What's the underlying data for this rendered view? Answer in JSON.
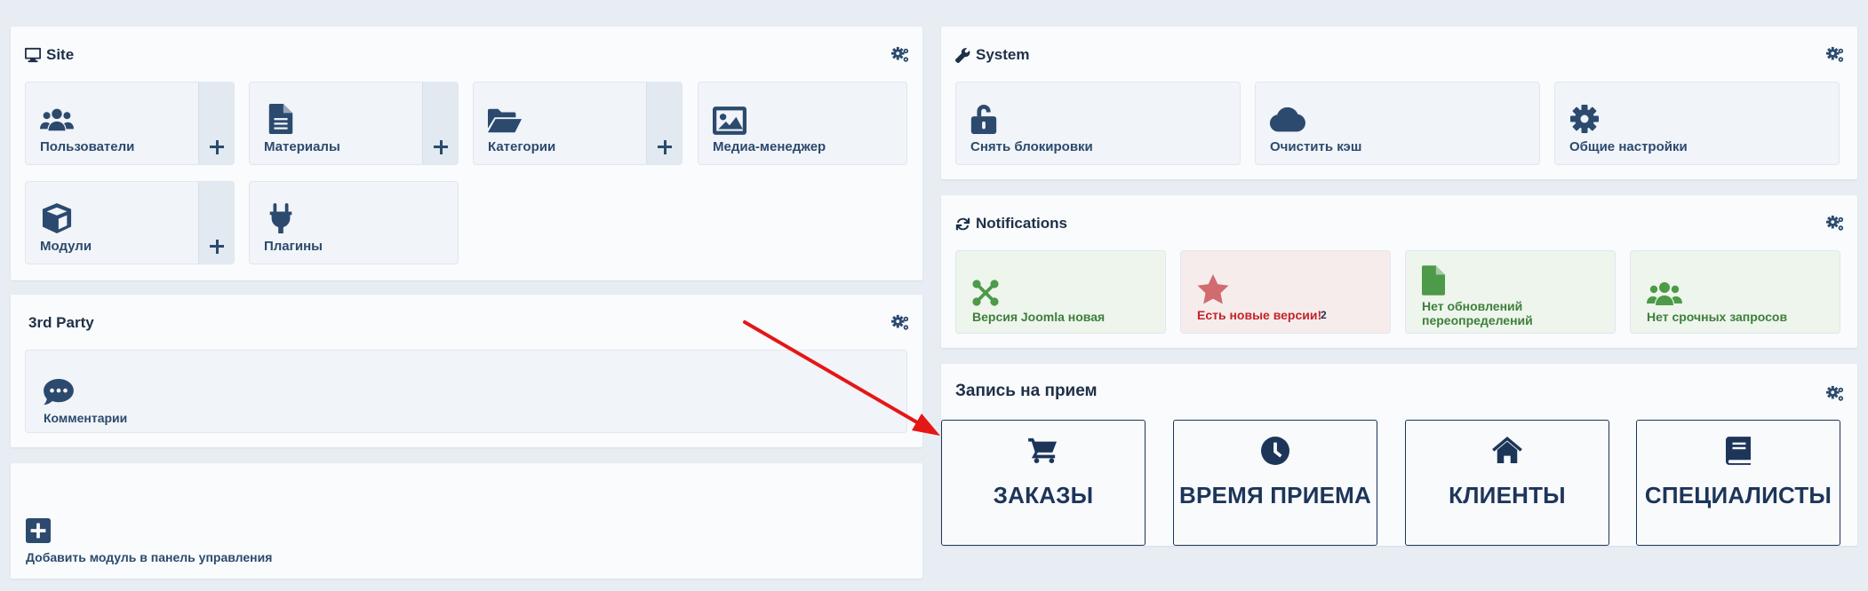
{
  "site": {
    "title": "Site",
    "tiles": [
      {
        "label": "Пользователи",
        "icon": "users-icon"
      },
      {
        "label": "Материалы",
        "icon": "file-icon"
      },
      {
        "label": "Категории",
        "icon": "folder-open-icon"
      },
      {
        "label": "Медиа-менеджер",
        "icon": "image-icon"
      },
      {
        "label": "Модули",
        "icon": "cube-icon"
      },
      {
        "label": "Плагины",
        "icon": "plug-icon"
      }
    ]
  },
  "third_party": {
    "title": "3rd Party",
    "tiles": [
      {
        "label": "Комментарии",
        "icon": "comment-dots-icon"
      }
    ]
  },
  "add_module": {
    "label": "Добавить модуль в панель управления",
    "icon": "plus-square-icon"
  },
  "system": {
    "title": "System",
    "tiles": [
      {
        "label": "Снять блокировки",
        "icon": "unlock-icon"
      },
      {
        "label": "Очистить кэш",
        "icon": "cloud-icon"
      },
      {
        "label": "Общие настройки",
        "icon": "cog-icon"
      }
    ]
  },
  "notifications": {
    "title": "Notifications",
    "items": [
      {
        "label": "Версия Joomla новая",
        "icon": "joomla-icon"
      },
      {
        "label": "Есть новые версии!",
        "count": "2",
        "icon": "star-icon"
      },
      {
        "label_line1": "Нет обновлений",
        "label_line2": "переопределений",
        "icon": "file-icon"
      },
      {
        "label": "Нет срочных запросов",
        "icon": "users-icon"
      }
    ]
  },
  "appointments": {
    "title": "Запись на прием",
    "buttons": [
      {
        "label": "ЗАКАЗЫ",
        "icon": "cart-icon"
      },
      {
        "label": "ВРЕМЯ ПРИЕМА",
        "icon": "clock-icon"
      },
      {
        "label": "КЛИЕНТЫ",
        "icon": "home-icon"
      },
      {
        "label": "СПЕЦИАЛИСТЫ",
        "icon": "book-icon"
      }
    ]
  },
  "colors": {
    "page_bg": "#e8edf3",
    "primary": "#1d3559",
    "tile_text": "#2b4a6e",
    "success_bg": "#edf5ec",
    "success_text": "#3e7f3b",
    "danger_bg": "#f6ecec",
    "danger_text": "#c42329",
    "annotation_arrow": "#e51616"
  }
}
